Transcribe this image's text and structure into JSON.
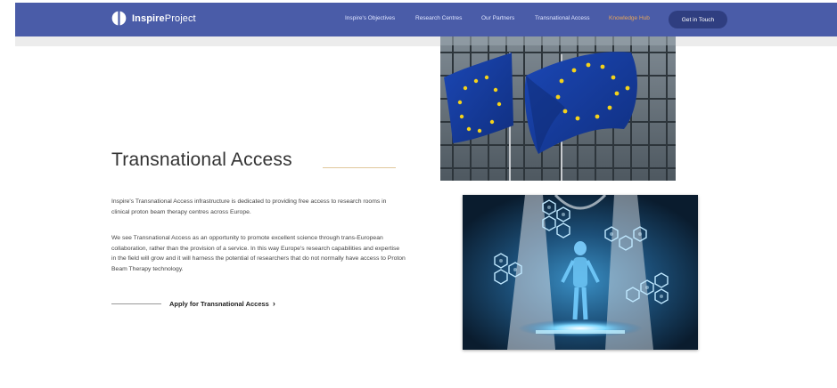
{
  "brand": {
    "bold": "Inspire",
    "regular": "Project"
  },
  "nav": {
    "items": [
      {
        "label": "Inspire's Objectives"
      },
      {
        "label": "Research Centres"
      },
      {
        "label": "Our Partners"
      },
      {
        "label": "Transnational Access"
      },
      {
        "label": "Knowledge Hub",
        "active": true
      }
    ],
    "cta": "Get in Touch"
  },
  "colors": {
    "nav_bg": "#4a5ca8",
    "accent": "#e8a65a",
    "cta_bg": "#2f3e80"
  },
  "main": {
    "title": "Transnational Access",
    "paragraphs": [
      "Inspire's Transnational Access infrastructure is dedicated to providing free access to research rooms in clinical proton beam therapy centres across Europe.",
      "We see Transnational Access as an opportunity to promote excellent science through trans-European collaboration, rather than the provision of a service. In this way Europe's research capabilities and expertise in the field will grow and it will harness the potential of researchers that do not normally have access to Proton Beam Therapy technology."
    ],
    "apply_link": "Apply for Transnational Access",
    "apply_icon": "chevron-right-icon"
  },
  "images": [
    {
      "name": "eu-flags-photo"
    },
    {
      "name": "medical-hologram-photo"
    }
  ]
}
